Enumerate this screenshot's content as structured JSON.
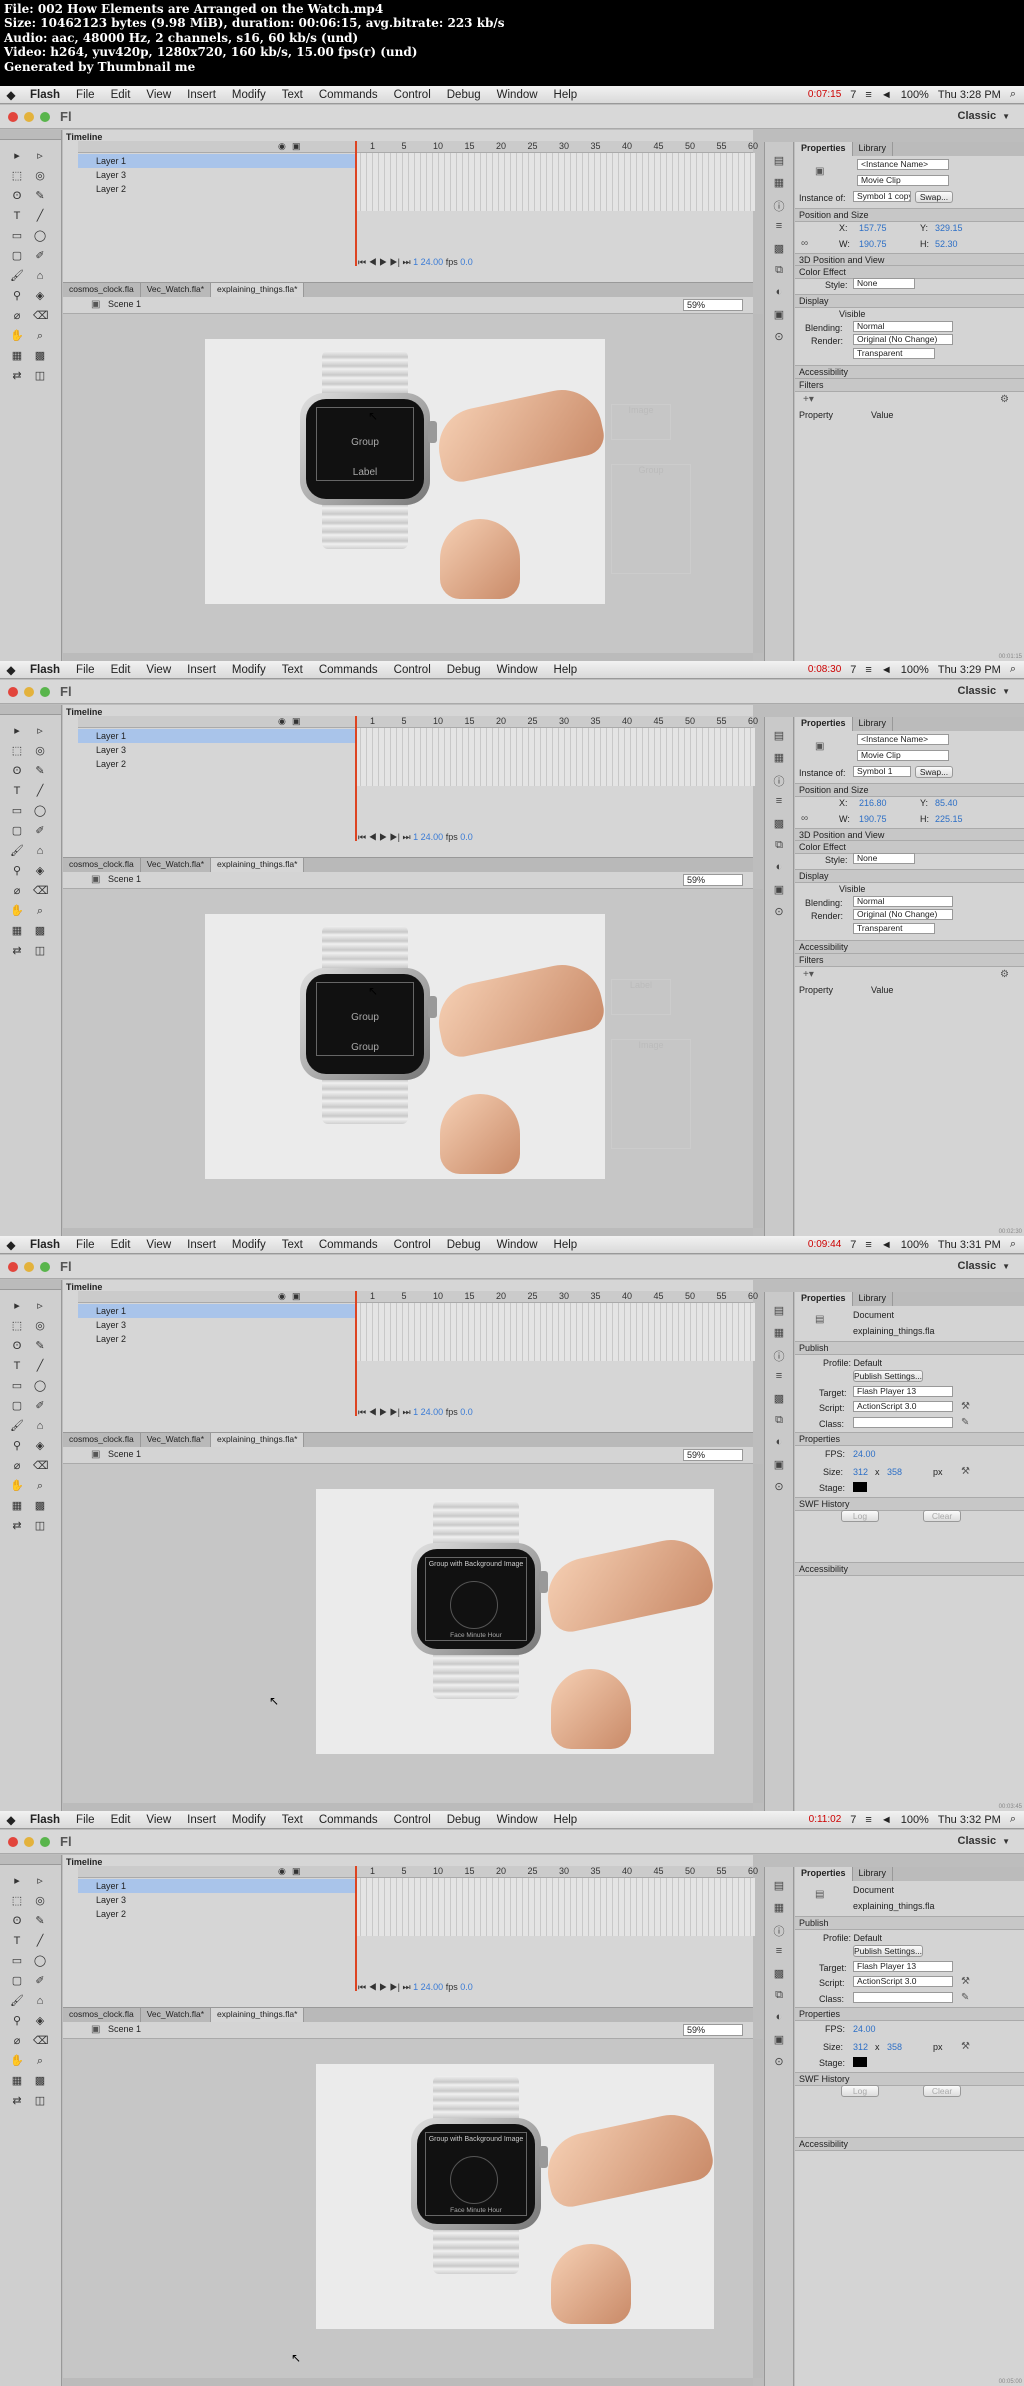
{
  "info": {
    "lines": [
      "File: 002 How Elements are Arranged on the Watch.mp4",
      "Size: 10462123 bytes (9.98 MiB), duration: 00:06:15, avg.bitrate: 223 kb/s",
      "Audio: aac, 48000 Hz, 2 channels, s16, 60 kb/s (und)",
      "Video: h264, yuv420p, 1280x720, 160 kb/s, 15.00 fps(r) (und)",
      "Generated by Thumbnail me"
    ]
  },
  "menubar": {
    "items": [
      "Flash",
      "File",
      "Edit",
      "View",
      "Insert",
      "Modify",
      "Text",
      "Commands",
      "Control",
      "Debug",
      "Window",
      "Help"
    ],
    "battery": "100%",
    "bluetooth_count": "7"
  },
  "appbar": {
    "logo": "Fl",
    "workspace": "Classic"
  },
  "timeline": {
    "tab": "Timeline",
    "frame_numbers": [
      "1",
      "5",
      "10",
      "15",
      "20",
      "25",
      "30",
      "35",
      "40",
      "45",
      "50",
      "55",
      "60"
    ],
    "layers": [
      "Layer 1",
      "Layer 3",
      "Layer 2"
    ],
    "fps": "24.00",
    "fps_unit": "fps",
    "time": "0.0",
    "current_frame": "1"
  },
  "doc_tabs": [
    "cosmos_clock.fla",
    "Vec_Watch.fla*",
    "explaining_things.fla*"
  ],
  "scene": "Scene 1",
  "zoom": "59%",
  "frames": [
    {
      "time": "Thu 3:28 PM",
      "rec": "0:07:15",
      "mode": "instance",
      "instance_name": "<Instance Name>",
      "type": "Movie Clip",
      "instance_of": "Symbol 1 copy",
      "x": "157.75",
      "y": "329.15",
      "w": "190.75",
      "h": "52.30",
      "screen_labels": [
        "Group",
        "Label"
      ],
      "ghost_labels": [
        "Image",
        "Group"
      ],
      "stamp": "00:01:15"
    },
    {
      "time": "Thu 3:29 PM",
      "rec": "0:08:30",
      "mode": "instance",
      "instance_name": "<Instance Name>",
      "type": "Movie Clip",
      "instance_of": "Symbol 1",
      "x": "216.80",
      "y": "85.40",
      "w": "190.75",
      "h": "225.15",
      "screen_labels": [
        "Group",
        "Group"
      ],
      "ghost_labels": [
        "Label",
        "Image"
      ],
      "stamp": "00:02:30"
    },
    {
      "time": "Thu 3:31 PM",
      "rec": "0:09:44",
      "mode": "document",
      "doc_name": "explaining_things.fla",
      "screen_title": "Group with Background Image",
      "screen_footer": "Face   Minute   Hour",
      "stamp": "00:03:45"
    },
    {
      "time": "Thu 3:32 PM",
      "rec": "0:11:02",
      "mode": "document",
      "doc_name": "explaining_things.fla",
      "screen_title": "Group with Background Image",
      "screen_footer": "Face   Minute   Hour",
      "stamp": "00:05:00"
    }
  ],
  "props": {
    "tabs": [
      "Properties",
      "Library"
    ],
    "instance_labels": {
      "instance_of": "Instance of:",
      "swap": "Swap...",
      "pos_section": "Position and Size",
      "x": "X:",
      "y": "Y:",
      "w": "W:",
      "h": "H:",
      "sec_3d": "3D Position and View",
      "sec_color": "Color Effect",
      "style": "Style:",
      "style_val": "None",
      "sec_display": "Display",
      "visible": "Visible",
      "blending": "Blending:",
      "blending_val": "Normal",
      "render": "Render:",
      "render_val": "Original (No Change)",
      "transparent": "Transparent",
      "sec_access": "Accessibility",
      "sec_filters": "Filters",
      "col_property": "Property",
      "col_value": "Value"
    },
    "document_labels": {
      "doc": "Document",
      "sec_publish": "Publish",
      "profile": "Profile: Default",
      "publish_settings": "Publish Settings...",
      "target": "Target:",
      "target_val": "Flash Player 13",
      "script": "Script:",
      "script_val": "ActionScript 3.0",
      "class": "Class:",
      "sec_props": "Properties",
      "fps": "FPS:",
      "fps_val": "24.00",
      "size": "Size:",
      "size_w": "312",
      "size_x": "x",
      "size_h": "358",
      "size_unit": "px",
      "stage": "Stage:",
      "sec_history": "SWF History",
      "log": "Log",
      "clear": "Clear",
      "sec_access": "Accessibility"
    }
  },
  "colors": {
    "accent": "#3a7bd5",
    "selection": "#a9c4ea",
    "playhead": "#dd4422",
    "stage_color": "#000000"
  }
}
